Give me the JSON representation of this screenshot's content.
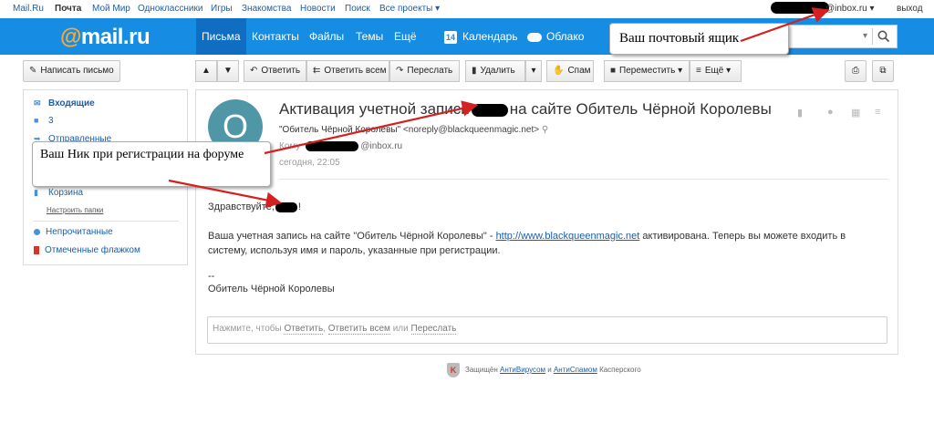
{
  "portal": {
    "links": [
      "Mail.Ru",
      "Почта",
      "Мой Мир",
      "Одноклассники",
      "Игры",
      "Знакомства",
      "Новости",
      "Поиск",
      "Все проекты ▾"
    ],
    "account_domain": "@inbox.ru ▾",
    "logout": "выход"
  },
  "header": {
    "logo_at": "@",
    "logo_text": "mail.ru",
    "nav": [
      "Письма",
      "Контакты",
      "Файлы",
      "Темы",
      "Ещё"
    ],
    "calendar_icon_text": "14",
    "calendar": "Календарь",
    "cloud": "Облако",
    "search_dropdown": "▾"
  },
  "toolbar": {
    "compose": "Написать письмо",
    "reply": "Ответить",
    "reply_all": "Ответить всем",
    "forward": "Переслать",
    "delete": "Удалить",
    "spam": "Спам",
    "move": "Переместить ▾",
    "more": "Ещё ▾"
  },
  "sidebar": {
    "inbox": "Входящие",
    "folder_3": "3",
    "sent": "Отправленные",
    "trash": "Корзина",
    "configure": "Настроить папки",
    "unread": "Непрочитанные",
    "flagged": "Отмеченные флажком"
  },
  "message": {
    "avatar_letter": "О",
    "subject_before": "Активация учетной записи",
    "subject_after": "на сайте Обитель Чёрной Королевы",
    "sender_name": "\"Обитель Чёрной Королевы\"",
    "sender_addr": "<noreply@blackqueenmagic.net>",
    "to_label": "Кому",
    "to_domain": "@inbox.ru",
    "date": "сегодня, 22:05",
    "greeting_before": "Здравствуйте,",
    "greeting_after": "!",
    "body_text_1": "Ваша учетная запись на сайте \"Обитель Чёрной Королевы\" - ",
    "body_link": "http://www.blackqueenmagic.net",
    "body_text_2": " активирована. Теперь вы можете входить в систему, используя имя и пароль, указанные при регистрации.",
    "sig_dash": "--",
    "signature": "Обитель Чёрной Королевы"
  },
  "reply_box": {
    "prefix": "Нажмите, чтобы ",
    "reply": "Ответить",
    "comma": ", ",
    "reply_all": "Ответить всем",
    "or": " или ",
    "forward": "Переслать"
  },
  "footer": {
    "shield_letter": "K",
    "prefix": "Защищён ",
    "antivirus": "АнтиВирусом",
    "and": " и ",
    "antispam": "АнтиСпамом",
    "suffix": " Касперского"
  },
  "annotations": {
    "mailbox": "Ваш почтовый ящик",
    "nick": "Ваш Ник при регистрации на форуме"
  },
  "colors": {
    "header_blue": "#168de2",
    "arrow_red": "#d42020"
  }
}
